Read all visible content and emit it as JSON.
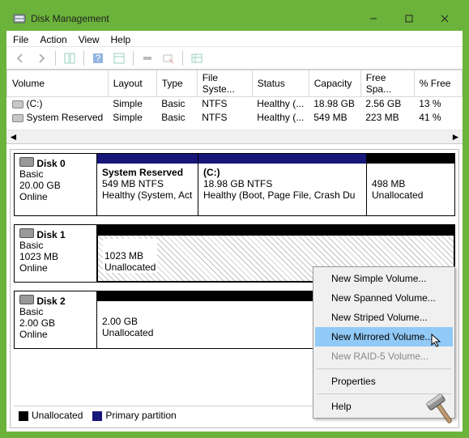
{
  "title": "Disk Management",
  "menus": {
    "file": "File",
    "action": "Action",
    "view": "View",
    "help": "Help"
  },
  "table": {
    "headers": {
      "volume": "Volume",
      "layout": "Layout",
      "type": "Type",
      "fs": "File Syste...",
      "status": "Status",
      "capacity": "Capacity",
      "free": "Free Spa...",
      "pct": "% Free"
    },
    "rows": [
      {
        "volume": "(C:)",
        "layout": "Simple",
        "type": "Basic",
        "fs": "NTFS",
        "status": "Healthy (...",
        "capacity": "18.98 GB",
        "free": "2.56 GB",
        "pct": "13 %"
      },
      {
        "volume": "System Reserved",
        "layout": "Simple",
        "type": "Basic",
        "fs": "NTFS",
        "status": "Healthy (...",
        "capacity": "549 MB",
        "free": "223 MB",
        "pct": "41 %"
      }
    ]
  },
  "disks": [
    {
      "name": "Disk 0",
      "type": "Basic",
      "size": "20.00 GB",
      "state": "Online",
      "parts": [
        {
          "title": "System Reserved",
          "line1": "549 MB NTFS",
          "line2": "Healthy (System, Act"
        },
        {
          "title": "(C:)",
          "line1": "18.98 GB NTFS",
          "line2": "Healthy (Boot, Page File, Crash Du"
        },
        {
          "title": "",
          "line1": "498 MB",
          "line2": "Unallocated"
        }
      ]
    },
    {
      "name": "Disk 1",
      "type": "Basic",
      "size": "1023 MB",
      "state": "Online",
      "parts": [
        {
          "title": "",
          "line1": "1023 MB",
          "line2": "Unallocated"
        }
      ]
    },
    {
      "name": "Disk 2",
      "type": "Basic",
      "size": "2.00 GB",
      "state": "Online",
      "parts": [
        {
          "title": "",
          "line1": "2.00 GB",
          "line2": "Unallocated"
        }
      ]
    }
  ],
  "legend": {
    "unalloc": "Unallocated",
    "primary": "Primary partition"
  },
  "ctx": {
    "simple": "New Simple Volume...",
    "spanned": "New Spanned Volume...",
    "striped": "New Striped Volume...",
    "mirrored": "New Mirrored Volume...",
    "raid5": "New RAID-5 Volume...",
    "props": "Properties",
    "help": "Help"
  }
}
